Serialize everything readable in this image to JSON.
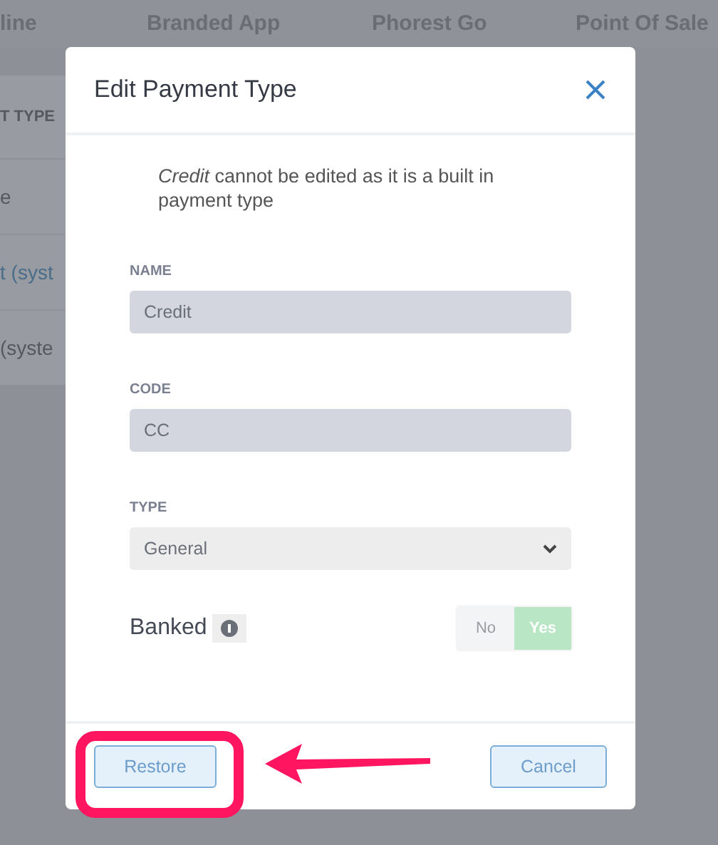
{
  "background_page": {
    "tabs": [
      "line",
      "Branded App",
      "Phorest Go",
      "Point Of Sale"
    ],
    "rows": [
      {
        "text": "T TYPE",
        "kind": "heading"
      },
      {
        "text": "e",
        "kind": "plain"
      },
      {
        "text": "t (syst",
        "kind": "link"
      },
      {
        "text": "(syste",
        "kind": "plain"
      }
    ]
  },
  "dialog": {
    "title": "Edit Payment Type",
    "notice": "*Credit* cannot be edited as it is a built in payment type",
    "fields": [
      {
        "label": "NAME",
        "value": "Credit",
        "kind": "text"
      },
      {
        "label": "CODE",
        "value": "CC",
        "kind": "text"
      },
      {
        "label": "TYPE",
        "value": "General",
        "kind": "select"
      }
    ],
    "banked": {
      "label": "Banked",
      "options": [
        {
          "label": "No",
          "selected": false
        },
        {
          "label": "Yes",
          "selected": true
        }
      ]
    },
    "buttons": [
      "Restore",
      "Cancel"
    ]
  }
}
